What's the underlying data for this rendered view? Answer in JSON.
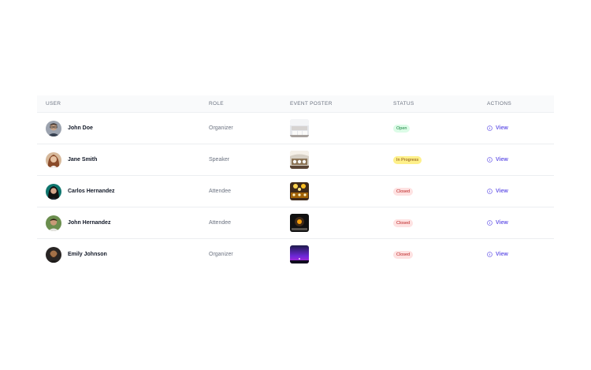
{
  "table": {
    "headers": {
      "user": "USER",
      "role": "ROLE",
      "poster": "EVENT POSTER",
      "status": "STATUS",
      "actions": "ACTIONS"
    },
    "rows": [
      {
        "name": "John Doe",
        "role": "Organizer",
        "status": "Open",
        "status_color": "#dcfce7",
        "status_text_color": "#15803d",
        "action": "View",
        "avatar_icon": "avatar-man-glasses",
        "poster_icon": "poster-wedding-hall"
      },
      {
        "name": "Jane Smith",
        "role": "Speaker",
        "status": "In Progress",
        "status_color": "#fef08a",
        "status_text_color": "#854d0e",
        "action": "View",
        "avatar_icon": "avatar-woman-curly-hair",
        "poster_icon": "poster-banquet-hall"
      },
      {
        "name": "Carlos Hernandez",
        "role": "Attendee",
        "status": "Closed",
        "status_color": "#fee2e2",
        "status_text_color": "#b91c1c",
        "action": "View",
        "avatar_icon": "avatar-woman-dark-hair",
        "poster_icon": "poster-chandelier-hall"
      },
      {
        "name": "John Hernandez",
        "role": "Attendee",
        "status": "Closed",
        "status_color": "#fee2e2",
        "status_text_color": "#b91c1c",
        "action": "View",
        "avatar_icon": "avatar-man-outdoor",
        "poster_icon": "poster-dark-venue"
      },
      {
        "name": "Emily Johnson",
        "role": "Organizer",
        "status": "Closed",
        "status_color": "#fee2e2",
        "status_text_color": "#b91c1c",
        "action": "View",
        "avatar_icon": "avatar-man-beard",
        "poster_icon": "poster-night-sky"
      }
    ]
  },
  "colors": {
    "accent": "#6d5ee8",
    "header_bg": "#f9fafb"
  }
}
